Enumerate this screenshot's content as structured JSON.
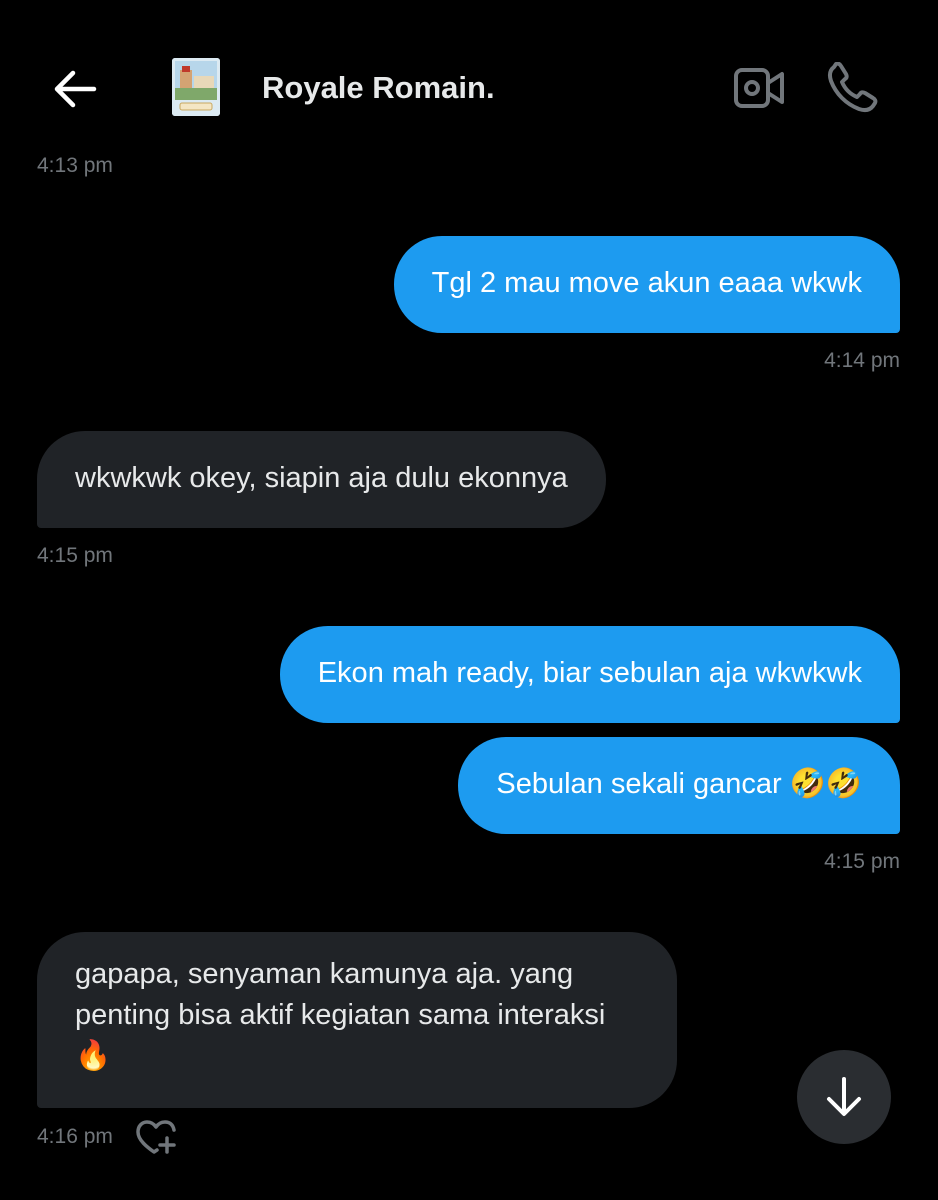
{
  "header": {
    "contact_name": "Royale Romain.",
    "icons": {
      "back": "arrow-left-icon",
      "video": "video-camera-icon",
      "call": "phone-icon",
      "scroll": "arrow-down-icon",
      "react": "heart-add-icon"
    }
  },
  "colors": {
    "background": "#000000",
    "outgoing_bubble": "#1d9bf0",
    "incoming_bubble": "#202327",
    "timestamp": "#71767b",
    "text": "#e7e9ea"
  },
  "messages": [
    {
      "direction": "in",
      "timestamp": "4:13 pm"
    },
    {
      "direction": "out",
      "text": "Tgl 2 mau move akun eaaa wkwk",
      "timestamp": "4:14 pm"
    },
    {
      "direction": "in",
      "text": "wkwkwk okey, siapin aja dulu ekonnya",
      "timestamp": "4:15 pm"
    },
    {
      "direction": "out",
      "text": "Ekon mah ready, biar sebulan aja wkwkwk"
    },
    {
      "direction": "out",
      "text": "Sebulan sekali gancar 🤣🤣",
      "timestamp": "4:15 pm"
    },
    {
      "direction": "in",
      "text": "gapapa, senyaman kamunya aja. yang penting bisa aktif kegiatan sama interaksi 🔥",
      "timestamp": "4:16 pm"
    }
  ]
}
